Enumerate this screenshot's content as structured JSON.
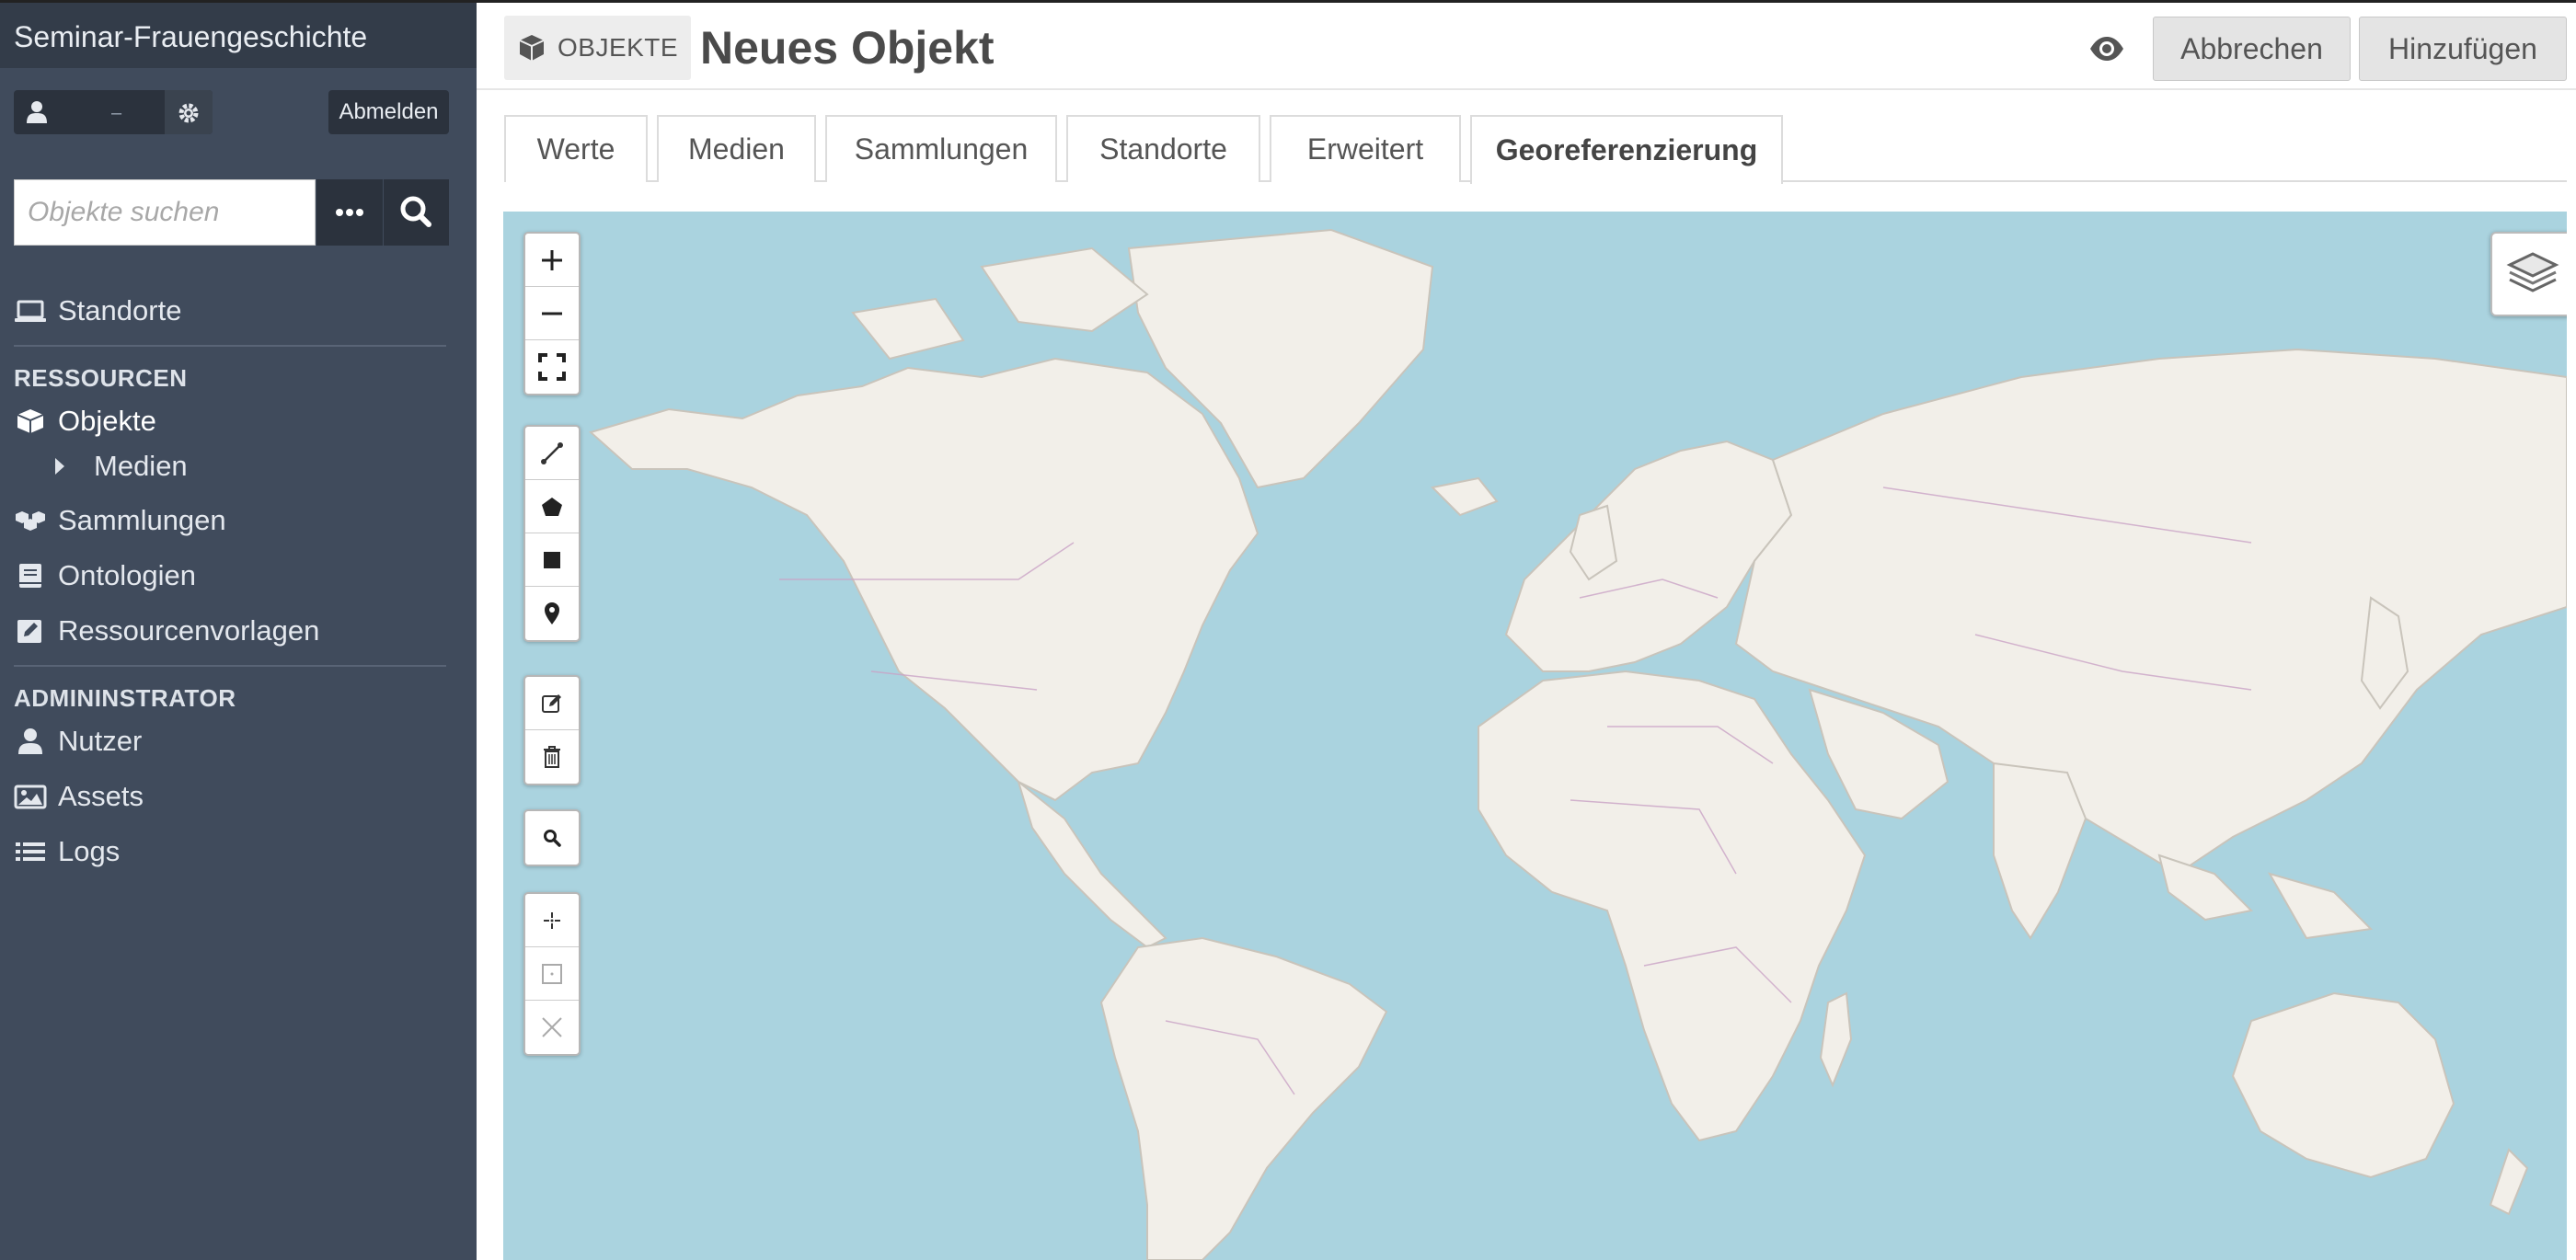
{
  "sidebar": {
    "site_title": "Seminar-Frauengeschichte",
    "user_name": "‒",
    "logout_label": "Abmelden",
    "search_placeholder": "Objekte suchen",
    "nav": {
      "standorte": "Standorte",
      "section_resources": "RESSOURCEN",
      "objekte": "Objekte",
      "medien": "Medien",
      "sammlungen": "Sammlungen",
      "ontologien": "Ontologien",
      "ressourcenvorlagen": "Ressourcenvorlagen",
      "section_admin": "ADMININSTRATOR",
      "nutzer": "Nutzer",
      "assets": "Assets",
      "logs": "Logs"
    }
  },
  "header": {
    "resource_badge": "OBJEKTE",
    "title": "Neues Objekt",
    "cancel_label": "Abbrechen",
    "add_label": "Hinzufügen"
  },
  "tabs": [
    {
      "label": "Werte"
    },
    {
      "label": "Medien"
    },
    {
      "label": "Sammlungen"
    },
    {
      "label": "Standorte"
    },
    {
      "label": "Erweitert"
    },
    {
      "label": "Georeferenzierung",
      "active": true
    }
  ],
  "map": {
    "controls": [
      "zoom-in-icon",
      "zoom-out-icon",
      "fullscreen-icon",
      "draw-line-icon",
      "draw-polygon-icon",
      "draw-rectangle-icon",
      "draw-marker-icon",
      "edit-layers-icon",
      "delete-layers-icon",
      "search-icon",
      "locate-icon",
      "fit-bounds-icon",
      "clear-icon"
    ],
    "layers_icon": "layers-icon",
    "colors": {
      "water": "#aad3df",
      "land": "#f2efe9",
      "border": "#c9a2c5"
    }
  }
}
